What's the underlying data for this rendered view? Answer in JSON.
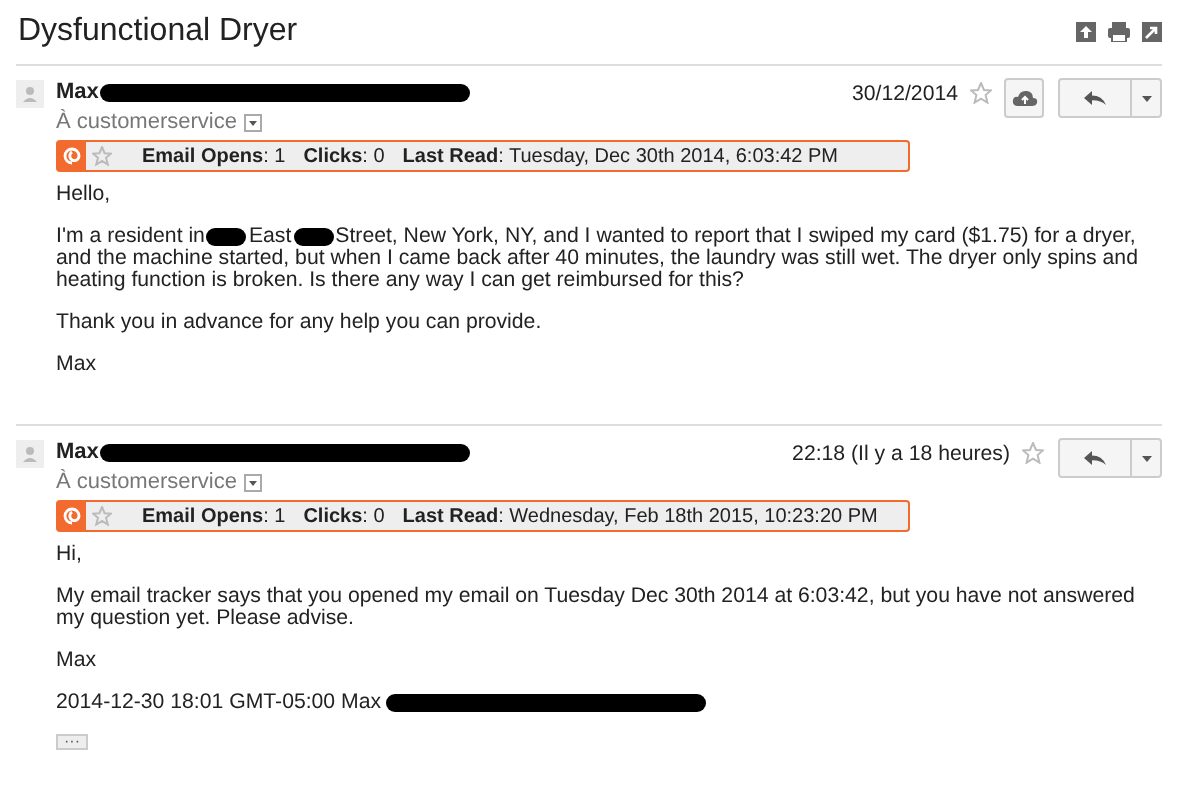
{
  "subject": "Dysfunctional Dryer",
  "messages": [
    {
      "sender": "Max",
      "to": "À customerservice",
      "date": "30/12/2014",
      "starred": false,
      "save_button": true,
      "tracker": {
        "opens_label": "Email Opens",
        "opens": ": 1",
        "clicks_label": "Clicks",
        "clicks": ": 0",
        "read_label": "Last Read",
        "read": ": Tuesday, Dec 30th 2014, 6:03:42 PM"
      },
      "body": [
        [
          {
            "kind": "text",
            "text": "Hello,"
          }
        ],
        [
          {
            "kind": "text",
            "text": "I'm a resident in"
          },
          {
            "kind": "redaction"
          },
          {
            "kind": "text",
            "text": "East"
          },
          {
            "kind": "redaction"
          },
          {
            "kind": "text",
            "text": "Street, New York, NY, and I wanted to report that I swiped my card ($1.75) for a dryer, and the machine started, but when I came back after 40 minutes, the laundry was still wet. The dryer only spins and heating function is broken. Is there any way I can get reimbursed for this?"
          }
        ],
        [
          {
            "kind": "text",
            "text": "Thank you in advance for any help you can provide."
          }
        ],
        [
          {
            "kind": "text",
            "text": "Max"
          }
        ]
      ]
    },
    {
      "sender": "Max",
      "to": "À customerservice",
      "date": "22:18 (Il y a 18 heures)",
      "starred": false,
      "save_button": false,
      "tracker": {
        "opens_label": "Email Opens",
        "opens": ": 1",
        "clicks_label": "Clicks",
        "clicks": ": 0",
        "read_label": "Last Read",
        "read": ": Wednesday, Feb 18th 2015, 10:23:20 PM"
      },
      "body": [
        [
          {
            "kind": "text",
            "text": "Hi,"
          }
        ],
        [
          {
            "kind": "text",
            "text": "My email tracker says that you opened my email on Tuesday Dec 30th 2014 at 6:03:42, but you have not answered my question yet. Please advise."
          }
        ],
        [
          {
            "kind": "text",
            "text": "Max"
          }
        ],
        [
          {
            "kind": "text",
            "text": "2014-12-30 18:01 GMT-05:00 Max"
          },
          {
            "kind": "redaction"
          }
        ]
      ],
      "quoted_toggle": "···"
    }
  ]
}
